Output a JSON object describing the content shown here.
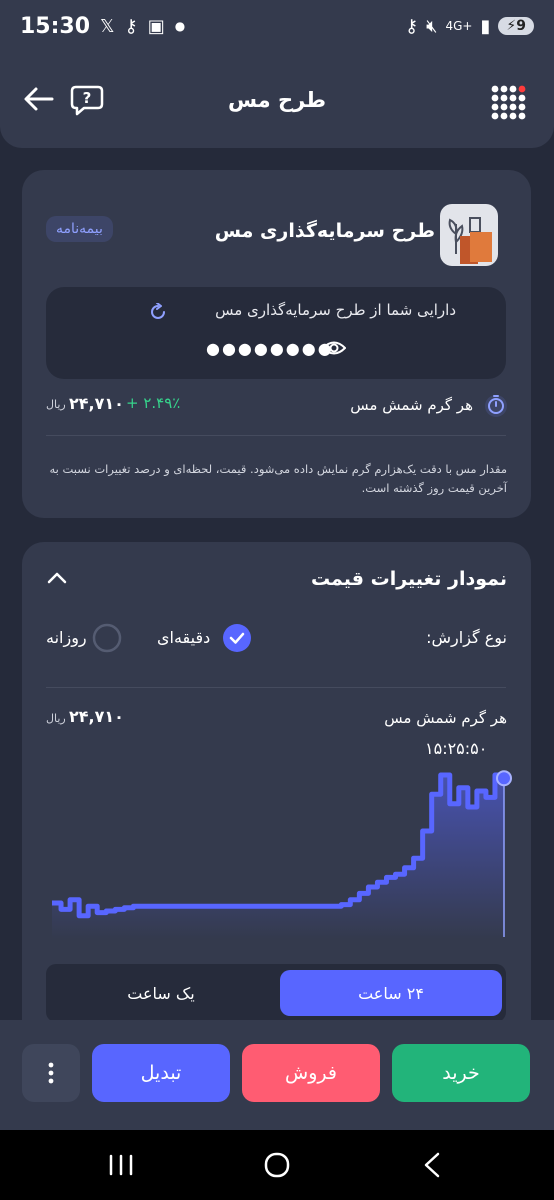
{
  "status_bar": {
    "time": "15:30",
    "battery": "9",
    "network": "4G+"
  },
  "header": {
    "title": "طرح مس"
  },
  "plan_card": {
    "badge": "بیمه‌نامه",
    "title": "طرح سرمایه‌گذاری مس",
    "asset_label": "دارایی شما از طرح سرمایه‌گذاری مس",
    "asset_hidden_value": "●●●●●●●●",
    "gram_label": "هر گرم شمش مس",
    "price": "۲۴,۷۱۰",
    "price_unit": "ریال",
    "price_change": "+ ۲.۴۹٪",
    "note": "مقدار مس با دقت یک‌هزارم گرم نمایش داده می‌شود. قیمت، لحظه‌ای و درصد تغییرات نسبت به آخرین قیمت روز گذشته است."
  },
  "chart_card": {
    "title": "نمودار تغییرات قیمت",
    "report_type_label": "نوع گزارش:",
    "option_minutely": "دقیقه‌ای",
    "option_daily": "روزانه",
    "selected_option": "minutely",
    "gram_label": "هر گرم شمش مس",
    "price": "۲۴,۷۱۰",
    "price_unit": "ریال",
    "tooltip_time": "۱۵:۲۵:۵۰",
    "range_24h": "۲۴ ساعت",
    "range_1h": "یک ساعت",
    "selected_range": "24h"
  },
  "actions": {
    "buy": "خرید",
    "sell": "فروش",
    "convert": "تبدیل"
  },
  "colors": {
    "accent": "#5866ff",
    "buy": "#22b47a",
    "sell": "#ff5c72",
    "positive": "#36d38c"
  },
  "chart_data": {
    "type": "line",
    "x": [
      0,
      0.02,
      0.04,
      0.06,
      0.08,
      0.1,
      0.12,
      0.14,
      0.16,
      0.18,
      0.2,
      0.25,
      0.3,
      0.35,
      0.4,
      0.45,
      0.5,
      0.55,
      0.6,
      0.62,
      0.64,
      0.66,
      0.68,
      0.7,
      0.72,
      0.74,
      0.76,
      0.78,
      0.8,
      0.82,
      0.84,
      0.86,
      0.88,
      0.9,
      0.92,
      0.94,
      0.96,
      0.98,
      1.0
    ],
    "values": [
      0.1,
      0.06,
      0.12,
      0.02,
      0.08,
      0.04,
      0.05,
      0.06,
      0.07,
      0.08,
      0.08,
      0.08,
      0.08,
      0.08,
      0.08,
      0.08,
      0.08,
      0.08,
      0.08,
      0.08,
      0.09,
      0.12,
      0.16,
      0.2,
      0.23,
      0.26,
      0.28,
      0.32,
      0.38,
      0.55,
      0.78,
      0.9,
      0.72,
      0.82,
      0.7,
      0.8,
      0.76,
      0.9,
      0.88
    ],
    "title": "",
    "xlabel": "",
    "ylabel": ""
  }
}
